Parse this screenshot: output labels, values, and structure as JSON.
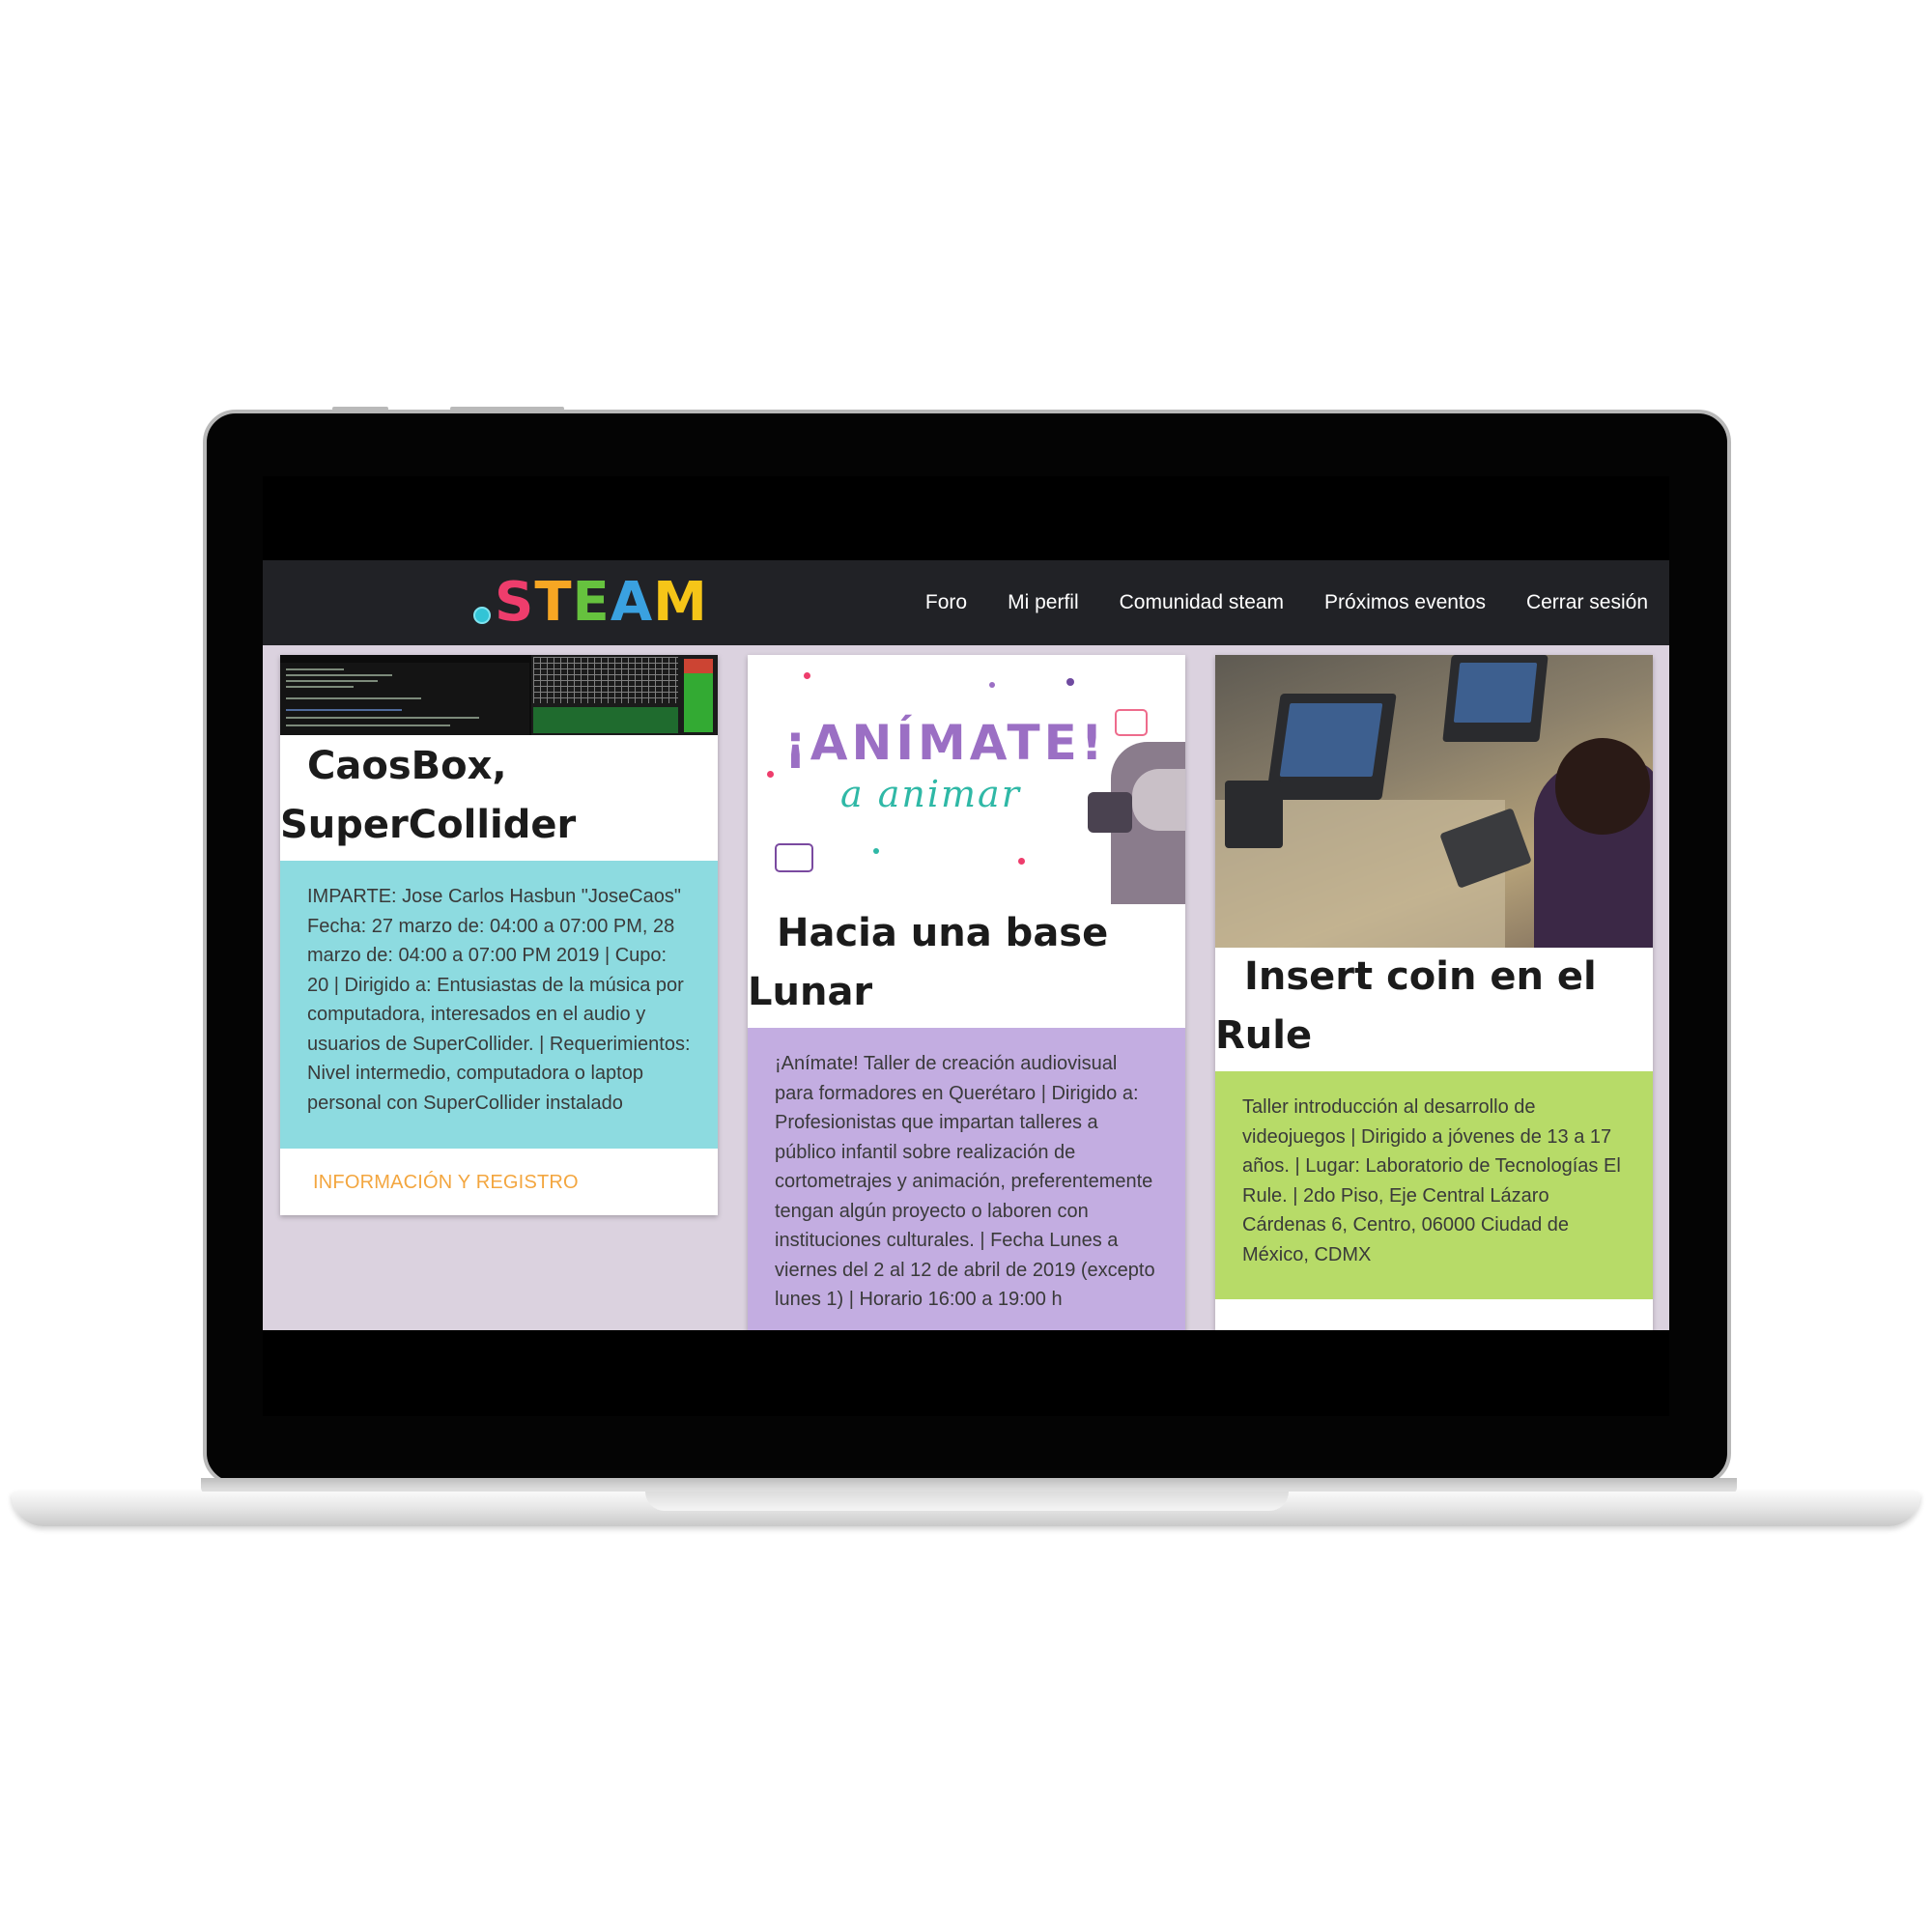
{
  "nav": {
    "logo_letters": [
      ".",
      "S",
      "T",
      "E",
      "A",
      "M"
    ],
    "logo_colors": [
      "#33c4d6",
      "#ee3d6c",
      "#f7a623",
      "#66c23e",
      "#3aa1e0",
      "#f5c518"
    ],
    "links": [
      "Foro",
      "Mi perfil",
      "Comunidad steam",
      "Próximos eventos",
      "Cerrar sesión"
    ]
  },
  "cards": [
    {
      "title": "CaosBox, SuperCollider",
      "body": "IMPARTE: Jose Carlos Hasbun \"JoseCaos\" Fecha: 27 marzo de: 04:00 a 07:00 PM, 28 marzo de: 04:00 a 07:00 PM 2019 | Cupo: 20 | Dirigido a: Entusiastas de la música por computadora, interesados en el audio y usuarios de SuperCollider. | Requerimientos: Nivel intermedio, computadora o laptop personal con SuperCollider instalado",
      "body_color": "#8ddbe0",
      "action": "INFORMACIÓN Y REGISTRO"
    },
    {
      "title": "Hacia una base Lunar",
      "image_headline": "¡ANÍMATE!",
      "image_sub": "a animar",
      "body": "¡Anímate! Taller de creación audiovisual para formadores en Querétaro | Dirigido a: Profesionistas que impartan talleres a público infantil sobre realización de cortometrajes y animación, preferentemente tengan algún proyecto o laboren con instituciones culturales. | Fecha Lunes a viernes del 2 al 12 de abril de 2019 (excepto lunes 1) | Horario 16:00 a 19:00 h",
      "body_color": "#c3ade1"
    },
    {
      "title": "Insert coin en el Rule",
      "body": "Taller introducción al desarrollo de videojuegos | Dirigido a jóvenes de 13 a 17 años. | Lugar: Laboratorio de Tecnologías El Rule. | 2do Piso, Eje Central Lázaro Cárdenas 6, Centro, 06000 Ciudad de México, CDMX",
      "body_color": "#b7db68"
    }
  ],
  "colors": {
    "navbar": "#212226",
    "page_background": "#dbd2df",
    "action_link": "#f3a63f"
  }
}
